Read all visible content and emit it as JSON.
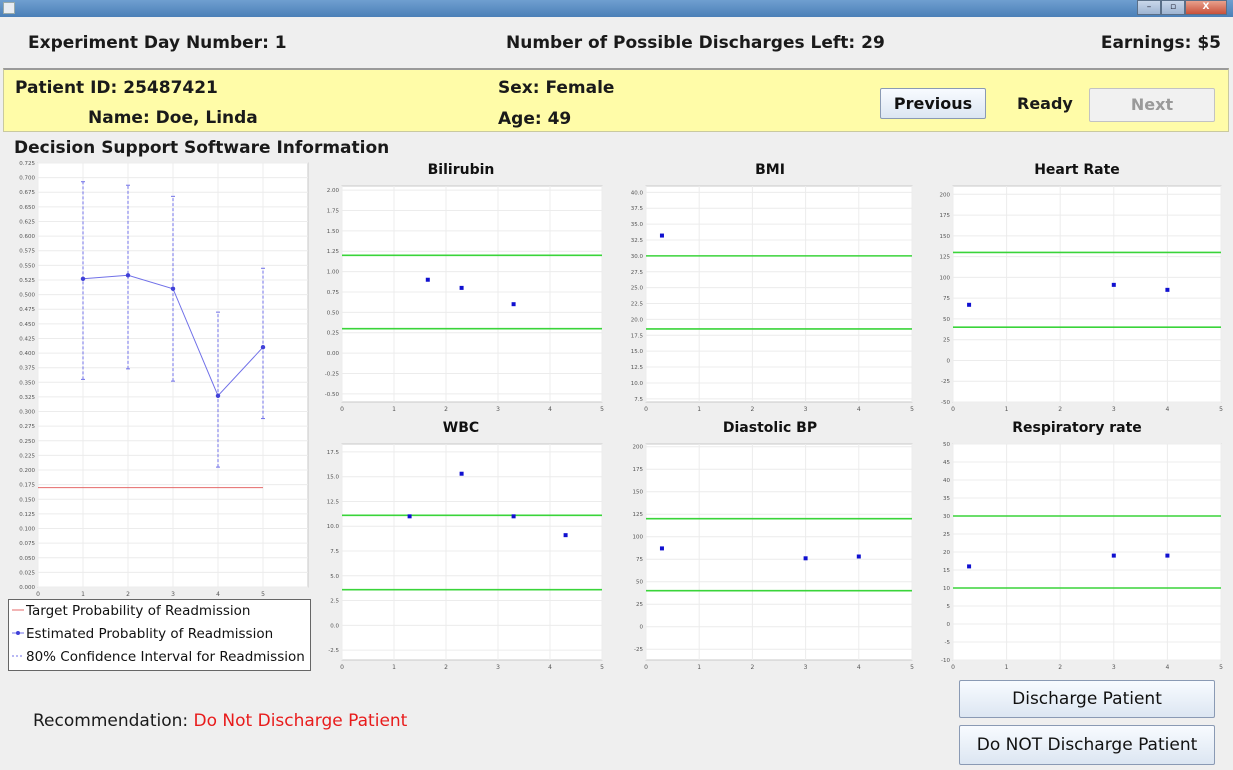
{
  "window": {
    "minimize": "–",
    "maximize": "▫",
    "close": "X"
  },
  "header": {
    "day": "Experiment Day Number: 1",
    "discharges": "Number of Possible Discharges Left: 29",
    "earnings": "Earnings: $5"
  },
  "patient": {
    "id": "Patient ID: 25487421",
    "name": "Name: Doe, Linda",
    "sex": "Sex: Female",
    "age": "Age: 49"
  },
  "nav": {
    "previous": "Previous",
    "status": "Ready",
    "next": "Next"
  },
  "section_title": "Decision Support Software Information",
  "legend": {
    "target": "Target Probability of Readmission",
    "estimated": "Estimated Probablity of Readmission",
    "ci": "80% Confidence Interval for Readmission"
  },
  "recommendation": {
    "label": "Recommendation:",
    "value": "Do Not Discharge Patient"
  },
  "actions": {
    "discharge": "Discharge Patient",
    "no_discharge": "Do NOT Discharge Patient"
  },
  "colors": {
    "threshold_line": "#3ad43a",
    "points": "#1010d0",
    "target_line": "#e46a6a",
    "estimate": "#7070e8",
    "recommendation": "#e81b1b",
    "panel": "#fffca8"
  },
  "chart_data": [
    {
      "type": "line",
      "title": "",
      "x": [
        1,
        2,
        3,
        4,
        5
      ],
      "series": [
        {
          "name": "Estimated Probablity of Readmission",
          "values": [
            0.527,
            0.533,
            0.51,
            0.327,
            0.41
          ]
        },
        {
          "name": "80% Confidence Interval for Readmission",
          "lower": [
            0.355,
            0.373,
            0.352,
            0.205,
            0.288
          ],
          "upper": [
            0.693,
            0.687,
            0.668,
            0.47,
            0.545
          ]
        },
        {
          "name": "Target Probability of Readmission",
          "values": [
            0.17,
            0.17,
            0.17,
            0.17,
            0.17
          ]
        }
      ],
      "xlim": [
        0,
        6
      ],
      "ylim": [
        0,
        0.725
      ],
      "xticks": [
        "0",
        "1",
        "2",
        "3",
        "4",
        "5"
      ],
      "yticks": [
        "0.000",
        "0.025",
        "0.050",
        "0.075",
        "0.100",
        "0.125",
        "0.150",
        "0.175",
        "0.200",
        "0.225",
        "0.250",
        "0.275",
        "0.300",
        "0.325",
        "0.350",
        "0.375",
        "0.400",
        "0.425",
        "0.450",
        "0.475",
        "0.500",
        "0.525",
        "0.550",
        "0.575",
        "0.600",
        "0.625",
        "0.650",
        "0.675",
        "0.700",
        "0.725"
      ]
    },
    {
      "type": "scatter",
      "title": "Bilirubin",
      "x": [
        1.65,
        2.3,
        3.3
      ],
      "y": [
        0.9,
        0.8,
        0.6
      ],
      "thresholds": [
        0.3,
        1.2
      ],
      "xlim": [
        0,
        5
      ],
      "ylim": [
        -0.6,
        2.05
      ],
      "xticks": [
        "0",
        "1",
        "2",
        "3",
        "4",
        "5"
      ],
      "yticks": [
        "-0.50",
        "-0.25",
        "0.00",
        "0.25",
        "0.50",
        "0.75",
        "1.00",
        "1.25",
        "1.50",
        "1.75",
        "2.00"
      ]
    },
    {
      "type": "scatter",
      "title": "BMI",
      "x": [
        0.3
      ],
      "y": [
        33.2
      ],
      "thresholds": [
        18.5,
        30
      ],
      "xlim": [
        0,
        5
      ],
      "ylim": [
        7,
        41
      ],
      "xticks": [
        "0",
        "1",
        "2",
        "3",
        "4",
        "5"
      ],
      "yticks": [
        "7.5",
        "10.0",
        "12.5",
        "15.0",
        "17.5",
        "20.0",
        "22.5",
        "25.0",
        "27.5",
        "30.0",
        "32.5",
        "35.0",
        "37.5",
        "40.0"
      ]
    },
    {
      "type": "scatter",
      "title": "Heart Rate",
      "x": [
        0.3,
        3,
        4
      ],
      "y": [
        67,
        91,
        85
      ],
      "thresholds": [
        40,
        130
      ],
      "xlim": [
        0,
        5
      ],
      "ylim": [
        -50,
        210
      ],
      "xticks": [
        "0",
        "1",
        "2",
        "3",
        "4",
        "5"
      ],
      "yticks": [
        "-50",
        "-25",
        "0",
        "25",
        "50",
        "75",
        "100",
        "125",
        "150",
        "175",
        "200"
      ]
    },
    {
      "type": "scatter",
      "title": "WBC",
      "x": [
        1.3,
        2.3,
        3.3,
        4.3
      ],
      "y": [
        11,
        15.3,
        11,
        9.1
      ],
      "thresholds": [
        3.6,
        11.1
      ],
      "xlim": [
        0,
        5
      ],
      "ylim": [
        -3.5,
        18.3
      ],
      "xticks": [
        "0",
        "1",
        "2",
        "3",
        "4",
        "5"
      ],
      "yticks": [
        "-2.5",
        "0.0",
        "2.5",
        "5.0",
        "7.5",
        "10.0",
        "12.5",
        "15.0",
        "17.5"
      ]
    },
    {
      "type": "scatter",
      "title": "Diastolic BP",
      "x": [
        0.3,
        3,
        4
      ],
      "y": [
        87,
        76,
        78
      ],
      "thresholds": [
        40,
        120
      ],
      "xlim": [
        0,
        5
      ],
      "ylim": [
        -37,
        203
      ],
      "xticks": [
        "0",
        "1",
        "2",
        "3",
        "4",
        "5"
      ],
      "yticks": [
        "-25",
        "0",
        "25",
        "50",
        "75",
        "100",
        "125",
        "150",
        "175",
        "200"
      ]
    },
    {
      "type": "scatter",
      "title": "Respiratory rate",
      "x": [
        0.3,
        3,
        4
      ],
      "y": [
        16,
        19,
        19
      ],
      "thresholds": [
        10,
        30
      ],
      "xlim": [
        0,
        5
      ],
      "ylim": [
        -10,
        50
      ],
      "xticks": [
        "0",
        "1",
        "2",
        "3",
        "4",
        "5"
      ],
      "yticks": [
        "-10",
        "-5",
        "0",
        "5",
        "10",
        "15",
        "20",
        "25",
        "30",
        "35",
        "40",
        "45",
        "50"
      ]
    }
  ]
}
